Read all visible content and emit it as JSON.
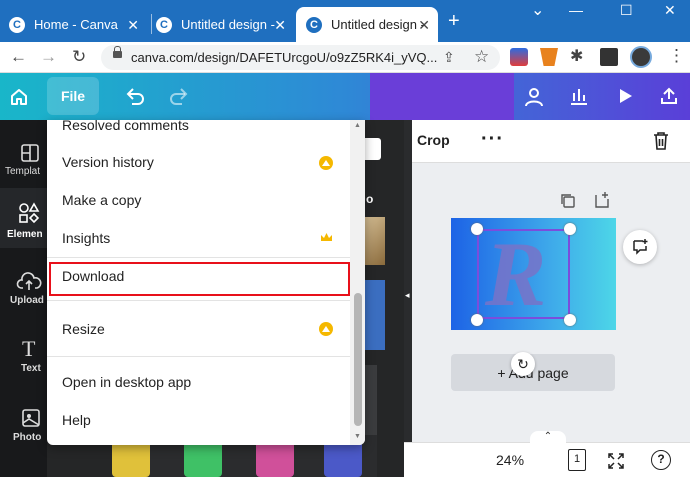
{
  "browser": {
    "tabs": [
      {
        "title": "Home - Canva",
        "active": false
      },
      {
        "title": "Untitled design -",
        "active": false
      },
      {
        "title": "Untitled design -",
        "active": true
      }
    ],
    "new_tab_icon": "plus-icon",
    "url": "canva.com/design/DAFETUrcgoU/o9zZ5RK4i_yVQ...",
    "window_controls": [
      "minimize",
      "maximize",
      "close"
    ],
    "accent": "#1f6fbf"
  },
  "header": {
    "file_label": "File",
    "gradient": [
      "#19b6c9",
      "#5a3fd8"
    ]
  },
  "rail": {
    "items": [
      {
        "label": "Templat",
        "icon": "templates-icon"
      },
      {
        "label": "Elemen",
        "icon": "elements-icon"
      },
      {
        "label": "Upload",
        "icon": "upload-icon"
      },
      {
        "label": "Text",
        "icon": "text-icon"
      },
      {
        "label": "Photo",
        "icon": "photos-icon"
      }
    ]
  },
  "panel": {
    "fragments": [
      "o"
    ]
  },
  "file_menu": {
    "items": [
      {
        "label": "Resolved comments",
        "premium": false
      },
      {
        "label": "Version history",
        "premium": true
      },
      {
        "label": "Make a copy",
        "premium": false
      },
      {
        "label": "Insights",
        "premium": true
      },
      {
        "label": "Download",
        "premium": false,
        "highlighted": true
      },
      {
        "label": "Resize",
        "premium": true
      },
      {
        "label": "Open in desktop app",
        "premium": false
      },
      {
        "label": "Help",
        "premium": false
      }
    ],
    "highlight_color": "#e8101a",
    "premium_color": "#f5b800"
  },
  "editor": {
    "crop_label": "Crop",
    "more_icon": "ellipsis-icon",
    "add_page_label": "+ Add page",
    "design_letter": "R",
    "zoom": "24%",
    "page_count": "1"
  }
}
